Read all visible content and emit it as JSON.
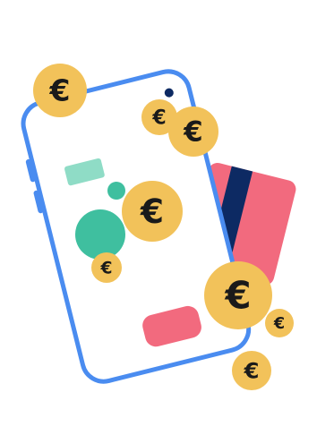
{
  "colors": {
    "background": "#ffffff",
    "phone_outline": "#4a8cf0",
    "phone_fill": "#ffffff",
    "camera_dot": "#0d2a63",
    "card_red": "#f26a7e",
    "card_navy": "#0d2a63",
    "accent_teal": "#3fbf9f",
    "accent_teal_light": "#8fdcc6",
    "button_red": "#f26a7e",
    "coin_fill": "#f2c25a",
    "coin_symbol": "#1a1a1a"
  },
  "icons": {
    "coin": "euro-coin-icon",
    "phone": "smartphone-icon",
    "card": "credit-card-icon"
  },
  "coins": [
    {
      "symbol": "€"
    },
    {
      "symbol": "€"
    },
    {
      "symbol": "€"
    },
    {
      "symbol": "€"
    },
    {
      "symbol": "€"
    },
    {
      "symbol": "€"
    },
    {
      "symbol": "€"
    },
    {
      "symbol": "€"
    }
  ]
}
